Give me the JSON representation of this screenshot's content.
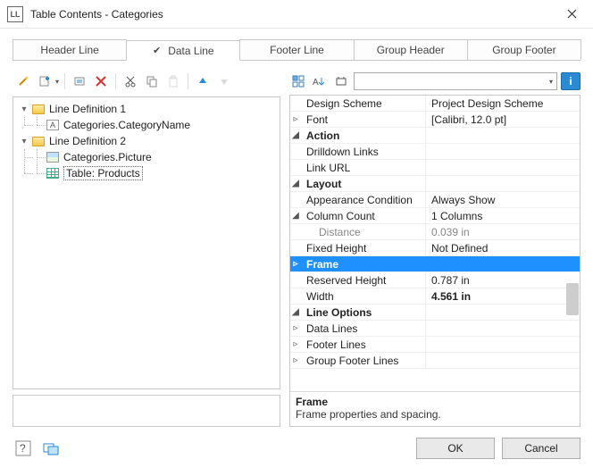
{
  "window": {
    "title": "Table Contents - Categories"
  },
  "tabs": [
    {
      "label": "Header Line",
      "active": false,
      "checked": false
    },
    {
      "label": "Data Line",
      "active": true,
      "checked": true
    },
    {
      "label": "Footer Line",
      "active": false,
      "checked": false
    },
    {
      "label": "Group Header",
      "active": false,
      "checked": false
    },
    {
      "label": "Group Footer",
      "active": false,
      "checked": false
    }
  ],
  "tree": {
    "line1": {
      "label": "Line Definition  1",
      "child": "Categories.CategoryName"
    },
    "line2": {
      "label": "Line Definition  2",
      "child1": "Categories.Picture",
      "child2": "Table: Products"
    }
  },
  "filter_value": "",
  "properties": {
    "design_scheme": {
      "label": "Design Scheme",
      "value": "Project Design Scheme"
    },
    "font": {
      "label": "Font",
      "value": "[Calibri, 12.0 pt]"
    },
    "action_header": {
      "label": "Action"
    },
    "drilldown_links": {
      "label": "Drilldown Links",
      "value": ""
    },
    "link_url": {
      "label": "Link URL",
      "value": ""
    },
    "layout_header": {
      "label": "Layout"
    },
    "appearance_condition": {
      "label": "Appearance Condition",
      "value": "Always Show"
    },
    "column_count": {
      "label": "Column Count",
      "value": "1 Columns"
    },
    "distance": {
      "label": "Distance",
      "value": "0.039 in"
    },
    "fixed_height": {
      "label": "Fixed Height",
      "value": "Not Defined"
    },
    "frame": {
      "label": "Frame",
      "value": ""
    },
    "reserved_height": {
      "label": "Reserved Height",
      "value": "0.787 in"
    },
    "width": {
      "label": "Width",
      "value": "4.561 in"
    },
    "line_options_header": {
      "label": "Line Options"
    },
    "data_lines": {
      "label": "Data Lines",
      "value": ""
    },
    "footer_lines": {
      "label": "Footer Lines",
      "value": ""
    },
    "group_footer_lines": {
      "label": "Group Footer Lines",
      "value": ""
    }
  },
  "help": {
    "title": "Frame",
    "desc": "Frame properties and spacing."
  },
  "buttons": {
    "ok": "OK",
    "cancel": "Cancel"
  },
  "icons": {
    "app": "LL"
  }
}
